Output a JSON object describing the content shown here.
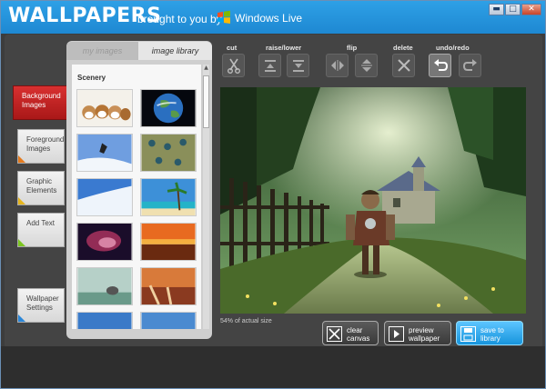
{
  "window": {
    "title": "WALLPAPERS",
    "subtitle": "brought to you by",
    "brand": "Windows Live",
    "controls": {
      "minimize": "▬",
      "maximize": "□",
      "close": "✕"
    }
  },
  "categories": [
    {
      "label": "Background Images",
      "active": true
    },
    {
      "label": "Foreground Images",
      "active": false,
      "mark_color": "#e47a1d"
    },
    {
      "label": "Graphic Elements",
      "active": false,
      "mark_color": "#e4b41d"
    },
    {
      "label": "Add Text",
      "active": false,
      "mark_color": "#7cc521"
    },
    {
      "label": "Wallpaper Settings",
      "active": false,
      "mark_color": "#2a86d8"
    }
  ],
  "library": {
    "tabs": [
      {
        "label": "my images",
        "active": false
      },
      {
        "label": "image library",
        "active": true
      }
    ],
    "section": "Scenery",
    "thumbnails": [
      "puppies",
      "earth",
      "snowboarder",
      "peacock-feathers",
      "snowy-slope",
      "tropical-beach",
      "nebula",
      "sunset-lake",
      "elephant-river",
      "waterfall-sunset",
      "sky"
    ]
  },
  "toolbar": {
    "groups": [
      {
        "label": "cut"
      },
      {
        "label": "raise/lower"
      },
      {
        "label": "flip"
      },
      {
        "label": "delete"
      },
      {
        "label": "undo/redo"
      }
    ],
    "tools": [
      {
        "name": "cut-icon"
      },
      {
        "name": "raise-icon"
      },
      {
        "name": "lower-icon"
      },
      {
        "name": "flip-horizontal-icon"
      },
      {
        "name": "flip-vertical-icon"
      },
      {
        "name": "delete-icon"
      },
      {
        "name": "undo-icon"
      },
      {
        "name": "redo-icon"
      }
    ]
  },
  "canvas": {
    "zoom_text": "54% of actual size"
  },
  "actions": {
    "clear": "clear canvas",
    "preview": "preview wallpaper",
    "save": "save to library"
  },
  "colors": {
    "accent": "#1e88d2",
    "active_category": "#c32222",
    "save_button": "#1794dc"
  }
}
